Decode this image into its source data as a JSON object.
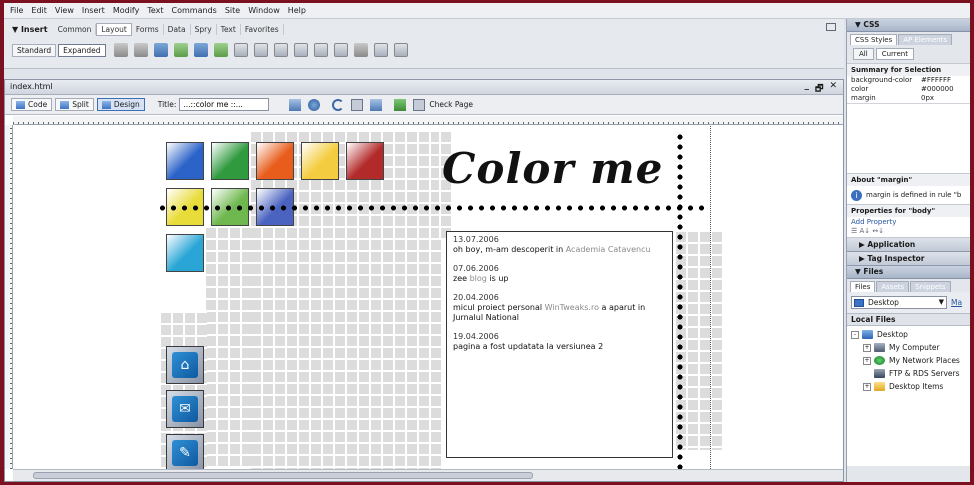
{
  "menu": [
    "File",
    "Edit",
    "View",
    "Insert",
    "Modify",
    "Text",
    "Commands",
    "Site",
    "Window",
    "Help"
  ],
  "insert_bar": {
    "panel_title": "▼ Insert",
    "tabs": [
      "Common",
      "Layout",
      "Forms",
      "Data",
      "Spry",
      "Text",
      "Favorites"
    ],
    "active_tab": "Layout",
    "modes": [
      "Standard",
      "Expanded"
    ]
  },
  "document": {
    "filename": "index.html",
    "window_controls": [
      "_",
      "🗗",
      "✕"
    ],
    "views": [
      "Code",
      "Split",
      "Design"
    ],
    "title_label": "Title:",
    "title_value": "...::color me ::...",
    "check_page": "Check Page"
  },
  "page": {
    "heading": "Color me",
    "swatch_colors": [
      "#2b63c8",
      "#2f9a3e",
      "#e85d1c",
      "#f3cd3f",
      "#b32a2a",
      "#e8dc3a",
      "#6fb84f",
      "#4a63c0",
      "#2aa6d6"
    ],
    "news": [
      {
        "date": "13.07.2006",
        "text": "oh boy, m-am descoperit in",
        "link": "Academia Catavencu",
        "tail": ""
      },
      {
        "date": "07.06.2006",
        "text": "zee",
        "link": "blog",
        "tail": "is up"
      },
      {
        "date": "20.04.2006",
        "text": "micul proiect personal",
        "link": "WinTweaks.ro",
        "tail": "a aparut in Jurnalul National"
      },
      {
        "date": "19.04.2006",
        "text": "pagina a fost updatata la versiunea 2",
        "link": "",
        "tail": ""
      }
    ]
  },
  "css_panel": {
    "title": "▼ CSS",
    "tabs": [
      "CSS Styles",
      "AP Elements"
    ],
    "buttons": [
      "All",
      "Current"
    ],
    "summary_label": "Summary for Selection",
    "properties": [
      {
        "name": "background-color",
        "value": "#FFFFFF"
      },
      {
        "name": "color",
        "value": "#000000"
      },
      {
        "name": "margin",
        "value": "0px"
      }
    ],
    "about_label": "About \"margin\"",
    "about_text": "margin is defined in rule \"b",
    "props_for_label": "Properties for \"body\"",
    "add_property": "Add Property",
    "prop_view_icons": "☰ A↓ ↔↓"
  },
  "collapsed_panels": [
    "▶ Application",
    "▶ Tag Inspector"
  ],
  "files_panel": {
    "title": "▼ Files",
    "tabs": [
      "Files",
      "Assets",
      "Snippets"
    ],
    "location": "Desktop",
    "map_label": "Ma",
    "local_files": "Local Files",
    "tree": [
      {
        "label": "Desktop",
        "icon": "desktop-icon",
        "indent": 0,
        "toggle": "-"
      },
      {
        "label": "My Computer",
        "icon": "computer-icon",
        "indent": 1,
        "toggle": "+"
      },
      {
        "label": "My Network Places",
        "icon": "network-icon",
        "indent": 1,
        "toggle": "+"
      },
      {
        "label": "FTP & RDS Servers",
        "icon": "ftp-icon",
        "indent": 1,
        "toggle": ""
      },
      {
        "label": "Desktop Items",
        "icon": "folder-icon",
        "indent": 1,
        "toggle": "+"
      }
    ]
  }
}
